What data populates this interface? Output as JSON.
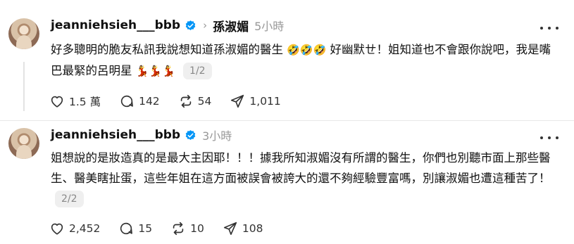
{
  "posts": [
    {
      "username": "jeanniehsieh___bbb",
      "reply_to": "孫淑媚",
      "time": "5小時",
      "text_before": "好多聰明的脆友私訊我說想知道孫淑媚的醫生",
      "emojis_1": "🤣🤣🤣",
      "text_middle": "好幽默ㄝ！姐知道也不會跟你說吧，我是嘴巴最緊的呂明星",
      "emojis_2": "💃💃💃",
      "page_badge": "1/2",
      "likes": "1.5 萬",
      "comments": "142",
      "reposts": "54",
      "shares": "1,011"
    },
    {
      "username": "jeanniehsieh___bbb",
      "time": "3小時",
      "text": "姐想說的是妝造真的是最大主因耶！！！據我所知淑媚沒有所謂的醫生，你們也別聽市面上那些醫生、醫美瞎扯蛋，這些年姐在這方面被誤會被誇大的還不夠經驗豐富嗎，別讓淑媚也遭這種苦了！",
      "page_badge": "2/2",
      "likes": "2,452",
      "comments": "15",
      "reposts": "10",
      "shares": "108"
    }
  ],
  "icons": {
    "verified": "verified-badge-icon",
    "chevron": "chevron-right-icon",
    "more": "more-horizontal-icon",
    "like": "heart-icon",
    "comment": "comment-icon",
    "repost": "repost-icon",
    "share": "share-icon"
  },
  "colors": {
    "verified": "#0095f6",
    "muted": "#999999",
    "text": "#101010"
  }
}
